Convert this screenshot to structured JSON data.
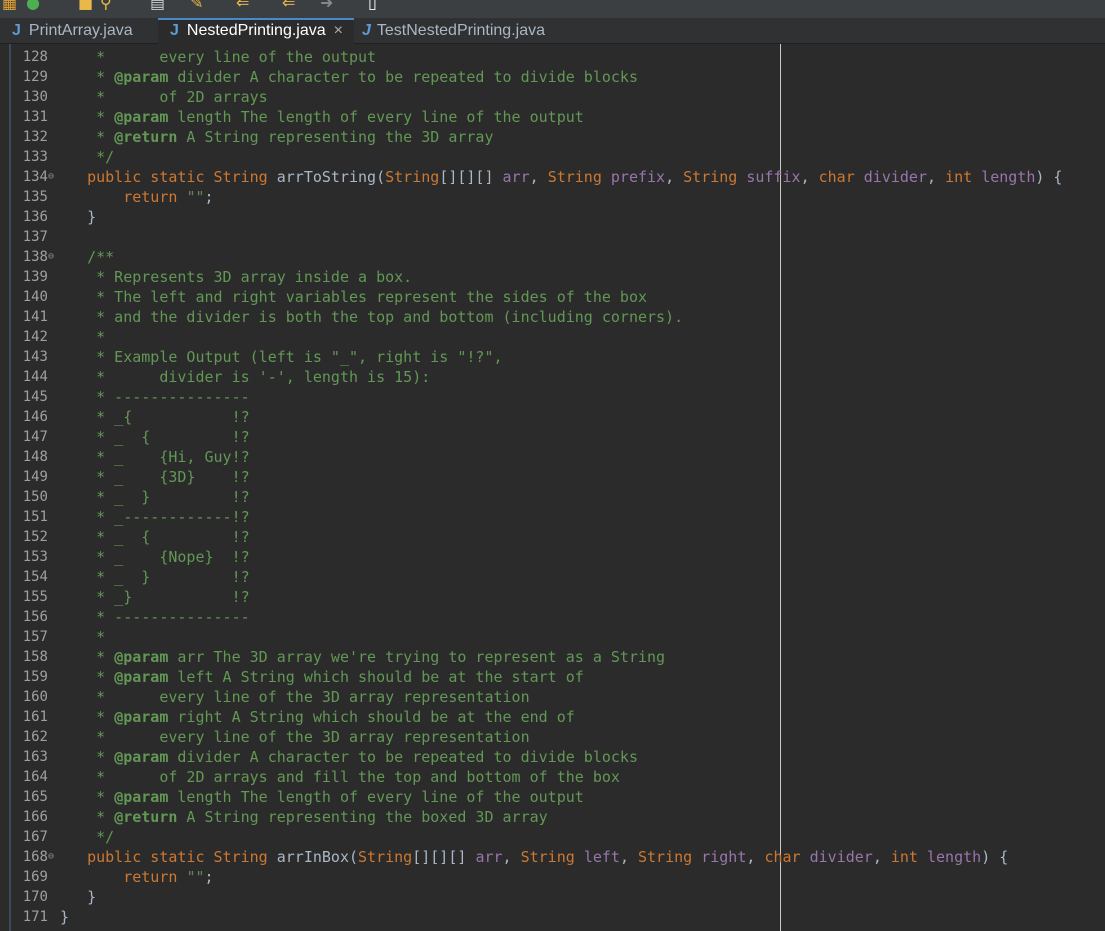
{
  "tabs": [
    {
      "label": "PrintArray.java",
      "active": false
    },
    {
      "label": "NestedPrinting.java",
      "active": true,
      "close": "×"
    },
    {
      "label": "TestNestedPrinting.java",
      "active": false
    }
  ],
  "toolbar": {
    "icons": [
      "grid-icon",
      "run-icon",
      "folder-icon",
      "search-icon",
      "doc-icon",
      "edit-icon",
      "back-icon",
      "forward-icon",
      "nav-icon",
      "file-icon"
    ]
  },
  "colors": {
    "background": "#2b2b2b",
    "comment": "#629755",
    "keyword": "#cc7832",
    "param": "#9876aa",
    "string": "#6a8759",
    "text": "#a9b7c6",
    "line_number": "#a0a0a0"
  },
  "lines": [
    {
      "n": "128",
      "parts": [
        {
          "t": "    *     ",
          "c": "cm"
        },
        {
          "t": " every line of the output",
          "c": "cm"
        }
      ]
    },
    {
      "n": "129",
      "parts": [
        {
          "t": "    * ",
          "c": "cm"
        },
        {
          "t": "@param",
          "c": "at"
        },
        {
          "t": " divider A character to be repeated to divide blocks",
          "c": "cm"
        }
      ]
    },
    {
      "n": "130",
      "parts": [
        {
          "t": "    *      of 2D arrays",
          "c": "cm"
        }
      ]
    },
    {
      "n": "131",
      "parts": [
        {
          "t": "    * ",
          "c": "cm"
        },
        {
          "t": "@param",
          "c": "at"
        },
        {
          "t": " length The length of every line of the output",
          "c": "cm"
        }
      ]
    },
    {
      "n": "132",
      "parts": [
        {
          "t": "    * ",
          "c": "cm"
        },
        {
          "t": "@return",
          "c": "at"
        },
        {
          "t": " A String representing the 3D array",
          "c": "cm"
        }
      ]
    },
    {
      "n": "133",
      "parts": [
        {
          "t": "    */",
          "c": "cm"
        }
      ]
    },
    {
      "n": "134",
      "fold": "⊖",
      "parts": [
        {
          "t": "   public static ",
          "c": "kw"
        },
        {
          "t": "String",
          "c": "ty"
        },
        {
          "t": " arrToString(",
          "c": "var"
        },
        {
          "t": "String",
          "c": "ty"
        },
        {
          "t": "[][][] ",
          "c": "var"
        },
        {
          "t": "arr",
          "c": "kw2"
        },
        {
          "t": ", ",
          "c": "var"
        },
        {
          "t": "String",
          "c": "ty"
        },
        {
          "t": " ",
          "c": "var"
        },
        {
          "t": "prefix",
          "c": "kw2"
        },
        {
          "t": ", ",
          "c": "var"
        },
        {
          "t": "String",
          "c": "ty"
        },
        {
          "t": " ",
          "c": "var"
        },
        {
          "t": "suffix",
          "c": "kw2"
        },
        {
          "t": ", ",
          "c": "var"
        },
        {
          "t": "char",
          "c": "kw"
        },
        {
          "t": " ",
          "c": "var"
        },
        {
          "t": "divider",
          "c": "kw2"
        },
        {
          "t": ", ",
          "c": "var"
        },
        {
          "t": "int",
          "c": "kw"
        },
        {
          "t": " ",
          "c": "var"
        },
        {
          "t": "length",
          "c": "kw2"
        },
        {
          "t": ") {",
          "c": "var"
        }
      ]
    },
    {
      "n": "135",
      "parts": [
        {
          "t": "       return ",
          "c": "kw"
        },
        {
          "t": "\"\"",
          "c": "str"
        },
        {
          "t": ";",
          "c": "var"
        }
      ]
    },
    {
      "n": "136",
      "parts": [
        {
          "t": "   }",
          "c": "var"
        }
      ]
    },
    {
      "n": "137",
      "parts": [
        {
          "t": "",
          "c": "var"
        }
      ]
    },
    {
      "n": "138",
      "fold": "⊖",
      "parts": [
        {
          "t": "   /**",
          "c": "cm"
        }
      ]
    },
    {
      "n": "139",
      "parts": [
        {
          "t": "    * Represents 3D array inside a box.",
          "c": "cm"
        }
      ]
    },
    {
      "n": "140",
      "parts": [
        {
          "t": "    * The left and right variables represent the sides of the box",
          "c": "cm"
        }
      ]
    },
    {
      "n": "141",
      "parts": [
        {
          "t": "    * and the divider is both the top and bottom (including corners).",
          "c": "cm"
        }
      ]
    },
    {
      "n": "142",
      "parts": [
        {
          "t": "    *",
          "c": "cm"
        }
      ]
    },
    {
      "n": "143",
      "parts": [
        {
          "t": "    * Example Output (left is \"_\", right is \"!?\",",
          "c": "cm"
        }
      ]
    },
    {
      "n": "144",
      "parts": [
        {
          "t": "    *      divider is '-', length is 15):",
          "c": "cm"
        }
      ]
    },
    {
      "n": "145",
      "parts": [
        {
          "t": "    * ---------------",
          "c": "cm"
        }
      ]
    },
    {
      "n": "146",
      "parts": [
        {
          "t": "    * _{           !?",
          "c": "cm"
        }
      ]
    },
    {
      "n": "147",
      "parts": [
        {
          "t": "    * _  {         !?",
          "c": "cm"
        }
      ]
    },
    {
      "n": "148",
      "parts": [
        {
          "t": "    * _    {Hi, Guy!?",
          "c": "cm"
        }
      ]
    },
    {
      "n": "149",
      "parts": [
        {
          "t": "    * _    {3D}    !?",
          "c": "cm"
        }
      ]
    },
    {
      "n": "150",
      "parts": [
        {
          "t": "    * _  }         !?",
          "c": "cm"
        }
      ]
    },
    {
      "n": "151",
      "parts": [
        {
          "t": "    * _------------!?",
          "c": "cm"
        }
      ]
    },
    {
      "n": "152",
      "parts": [
        {
          "t": "    * _  {         !?",
          "c": "cm"
        }
      ]
    },
    {
      "n": "153",
      "parts": [
        {
          "t": "    * _    {Nope}  !?",
          "c": "cm"
        }
      ]
    },
    {
      "n": "154",
      "parts": [
        {
          "t": "    * _  }         !?",
          "c": "cm"
        }
      ]
    },
    {
      "n": "155",
      "parts": [
        {
          "t": "    * _}           !?",
          "c": "cm"
        }
      ]
    },
    {
      "n": "156",
      "parts": [
        {
          "t": "    * ---------------",
          "c": "cm"
        }
      ]
    },
    {
      "n": "157",
      "parts": [
        {
          "t": "    *",
          "c": "cm"
        }
      ]
    },
    {
      "n": "158",
      "parts": [
        {
          "t": "    * ",
          "c": "cm"
        },
        {
          "t": "@param",
          "c": "at"
        },
        {
          "t": " arr The 3D array we're trying to represent as a String",
          "c": "cm"
        }
      ]
    },
    {
      "n": "159",
      "parts": [
        {
          "t": "    * ",
          "c": "cm"
        },
        {
          "t": "@param",
          "c": "at"
        },
        {
          "t": " left A String which should be at the start of",
          "c": "cm"
        }
      ]
    },
    {
      "n": "160",
      "parts": [
        {
          "t": "    *      every line of the 3D array representation",
          "c": "cm"
        }
      ]
    },
    {
      "n": "161",
      "parts": [
        {
          "t": "    * ",
          "c": "cm"
        },
        {
          "t": "@param",
          "c": "at"
        },
        {
          "t": " right A String which should be at the end of",
          "c": "cm"
        }
      ]
    },
    {
      "n": "162",
      "parts": [
        {
          "t": "    *      every line of the 3D array representation",
          "c": "cm"
        }
      ]
    },
    {
      "n": "163",
      "parts": [
        {
          "t": "    * ",
          "c": "cm"
        },
        {
          "t": "@param",
          "c": "at"
        },
        {
          "t": " divider A character to be repeated to divide blocks",
          "c": "cm"
        }
      ]
    },
    {
      "n": "164",
      "parts": [
        {
          "t": "    *      of 2D arrays and fill the top and bottom of the box",
          "c": "cm"
        }
      ]
    },
    {
      "n": "165",
      "parts": [
        {
          "t": "    * ",
          "c": "cm"
        },
        {
          "t": "@param",
          "c": "at"
        },
        {
          "t": " length The length of every line of the output",
          "c": "cm"
        }
      ]
    },
    {
      "n": "166",
      "parts": [
        {
          "t": "    * ",
          "c": "cm"
        },
        {
          "t": "@return",
          "c": "at"
        },
        {
          "t": " A String representing the boxed 3D array",
          "c": "cm"
        }
      ]
    },
    {
      "n": "167",
      "parts": [
        {
          "t": "    */",
          "c": "cm"
        }
      ]
    },
    {
      "n": "168",
      "fold": "⊖",
      "parts": [
        {
          "t": "   public static ",
          "c": "kw"
        },
        {
          "t": "String",
          "c": "ty"
        },
        {
          "t": " arrInBox(",
          "c": "var"
        },
        {
          "t": "String",
          "c": "ty"
        },
        {
          "t": "[][][] ",
          "c": "var"
        },
        {
          "t": "arr",
          "c": "kw2"
        },
        {
          "t": ", ",
          "c": "var"
        },
        {
          "t": "String",
          "c": "ty"
        },
        {
          "t": " ",
          "c": "var"
        },
        {
          "t": "left",
          "c": "kw2"
        },
        {
          "t": ", ",
          "c": "var"
        },
        {
          "t": "String",
          "c": "ty"
        },
        {
          "t": " ",
          "c": "var"
        },
        {
          "t": "right",
          "c": "kw2"
        },
        {
          "t": ", ",
          "c": "var"
        },
        {
          "t": "char",
          "c": "kw"
        },
        {
          "t": " ",
          "c": "var"
        },
        {
          "t": "divider",
          "c": "kw2"
        },
        {
          "t": ", ",
          "c": "var"
        },
        {
          "t": "int",
          "c": "kw"
        },
        {
          "t": " ",
          "c": "var"
        },
        {
          "t": "length",
          "c": "kw2"
        },
        {
          "t": ") {",
          "c": "var"
        }
      ]
    },
    {
      "n": "169",
      "parts": [
        {
          "t": "       return ",
          "c": "kw"
        },
        {
          "t": "\"\"",
          "c": "str"
        },
        {
          "t": ";",
          "c": "var"
        }
      ]
    },
    {
      "n": "170",
      "parts": [
        {
          "t": "   }",
          "c": "var"
        }
      ]
    },
    {
      "n": "171",
      "parts": [
        {
          "t": "}",
          "c": "var"
        }
      ]
    }
  ]
}
